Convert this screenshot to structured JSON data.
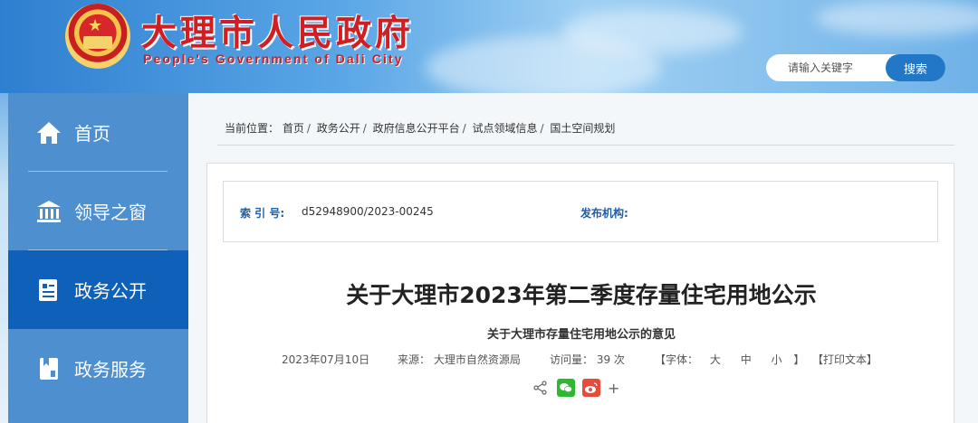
{
  "header": {
    "title": "大理市人民政府",
    "subtitle": "People's Government of Dali City",
    "search_placeholder": "请输入关键字",
    "search_button": "搜索"
  },
  "sidebar": {
    "items": [
      {
        "label": "首页",
        "icon": "home-icon"
      },
      {
        "label": "领导之窗",
        "icon": "building-icon"
      },
      {
        "label": "政务公开",
        "icon": "document-icon",
        "active": true
      },
      {
        "label": "政务服务",
        "icon": "service-icon"
      }
    ]
  },
  "breadcrumb": {
    "prefix": "当前位置：",
    "items": [
      "首页",
      "政务公开",
      "政府信息公开平台",
      "试点领域信息",
      "国土空间规划"
    ]
  },
  "meta": {
    "index_label": "索 引 号:",
    "index_value": "d52948900/2023-00245",
    "publisher_label": "发布机构:",
    "publisher_value": ""
  },
  "article": {
    "title": "关于大理市2023年第二季度存量住宅用地公示",
    "subtitle": "关于大理市存量住宅用地公示的意见",
    "date": "2023年07月10日",
    "source_label": "来源：",
    "source_value": "大理市自然资源局",
    "views_label": "访问量：",
    "views_value": "39 次",
    "font_open": "【字体：",
    "font_large": "大",
    "font_medium": "中",
    "font_small": "小",
    "font_close": "】",
    "print_label": "【打印文本】"
  },
  "colors": {
    "title_red": "#d01e22",
    "nav_active": "#0f60b8",
    "nav_bg": "#4d8fcf",
    "accent_blue": "#2277c7"
  }
}
